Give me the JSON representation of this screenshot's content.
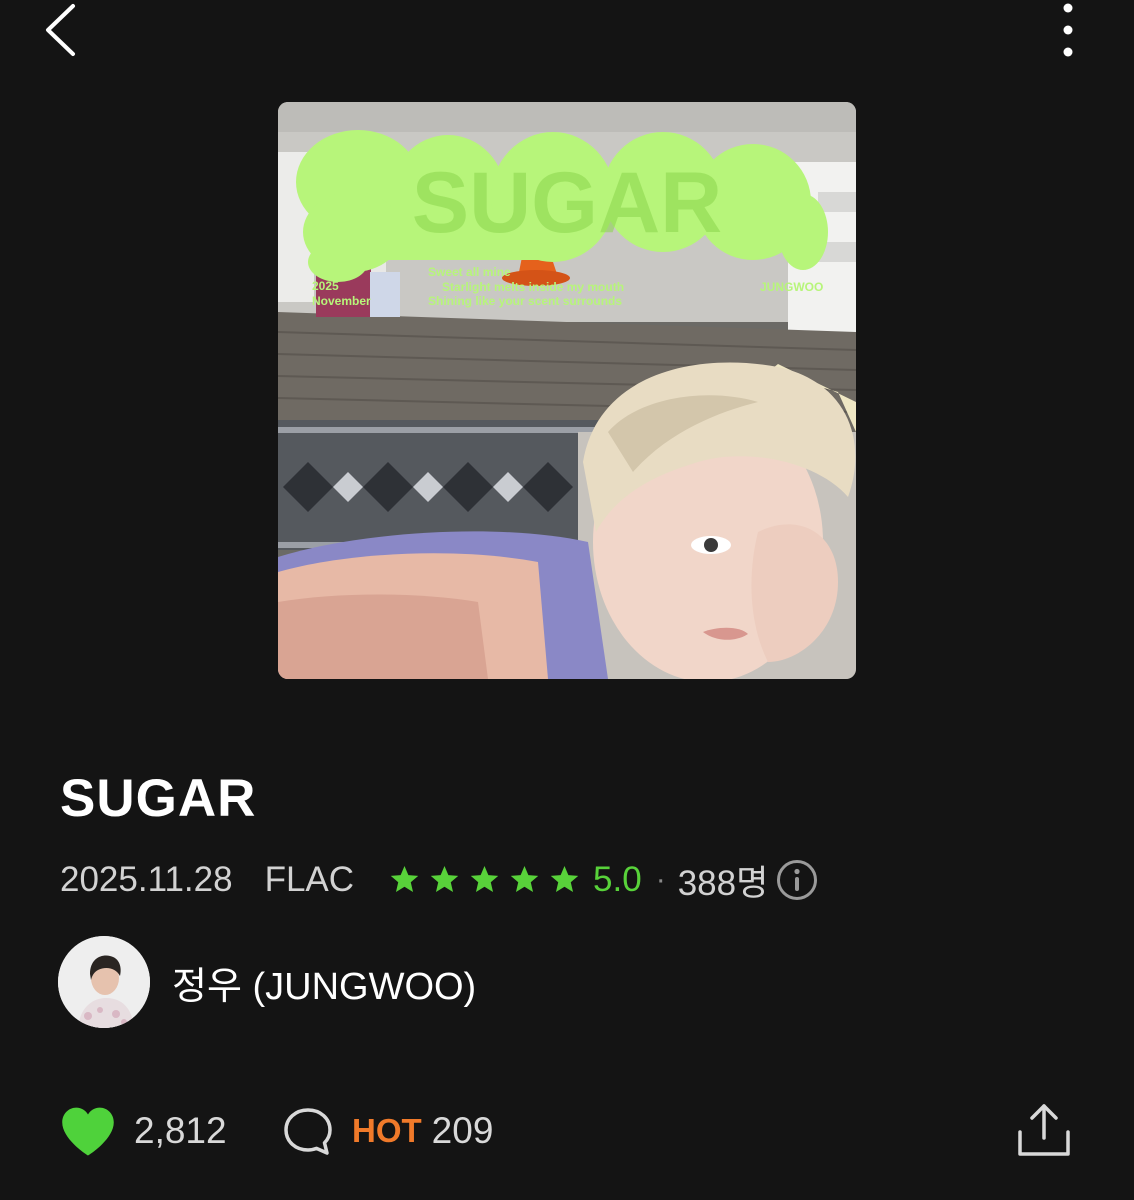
{
  "topbar": {
    "back_icon": "chevron-left-icon",
    "more_icon": "more-vertical-icon"
  },
  "cover": {
    "title_art": "SUGAR",
    "date_line1": "2025",
    "date_line2": "November",
    "lyric_line1": "Sweet all mine",
    "lyric_line2": "Starlight melts inside my mouth",
    "lyric_line3": "Shining like your scent surrounds",
    "artist_art": "JUNGWOO",
    "accent": "#b7f57a"
  },
  "song": {
    "title": "SUGAR",
    "date": "2025.11.28",
    "format": "FLAC",
    "stars": 5,
    "rating": "5.0",
    "separator": "·",
    "rating_count": "388명"
  },
  "artist": {
    "name": "정우 (JUNGWOO)"
  },
  "actions": {
    "likes": "2,812",
    "hot_label": "HOT",
    "comments": "209"
  },
  "colors": {
    "star_green": "#58d23a",
    "heart_green": "#4fd23b",
    "hot_orange": "#f07a2a",
    "background": "#141414"
  }
}
